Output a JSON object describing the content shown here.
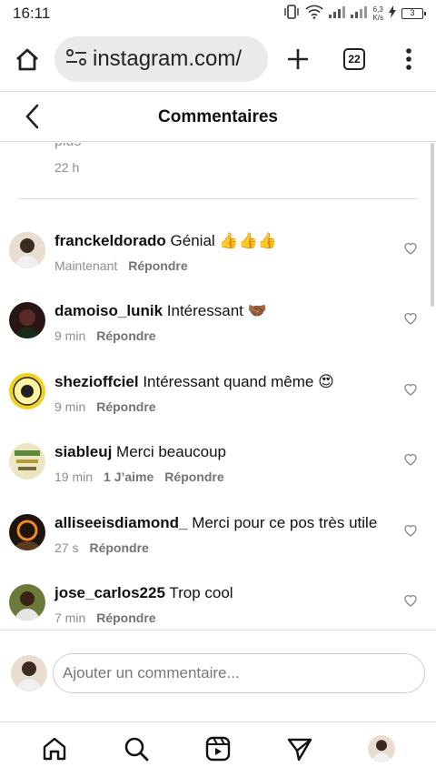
{
  "status_bar": {
    "time": "16:11",
    "speed_value": "6,3",
    "speed_unit": "K/s",
    "battery": "3"
  },
  "browser": {
    "url": "instagram.com/",
    "tab_count": "22"
  },
  "header": {
    "title": "Commentaires"
  },
  "previous_comment": {
    "text_tail": "plus",
    "time": "22 h"
  },
  "comments": [
    {
      "user": "franckeldorado",
      "text": "Génial 👍👍👍",
      "time": "Maintenant",
      "likes": "",
      "reply": "Répondre",
      "avatar_color": "#d8c7b5"
    },
    {
      "user": "damoiso_lunik",
      "text": "Intéressant 🤝🏾",
      "time": "9 min",
      "likes": "",
      "reply": "Répondre",
      "avatar_color": "#3a1a1a"
    },
    {
      "user": "shezioffciel",
      "text": "Intéressant quand même 😍",
      "time": "9 min",
      "likes": "",
      "reply": "Répondre",
      "avatar_color": "#f1d21c"
    },
    {
      "user": "siableuj",
      "text": "Merci beaucoup",
      "time": "19 min",
      "likes": "1 J’aime",
      "reply": "Répondre",
      "avatar_color": "#e9e2b8"
    },
    {
      "user": "alliseeisdiamond_",
      "text": "Merci pour ce pos très utile",
      "time": "27 s",
      "likes": "",
      "reply": "Répondre",
      "avatar_color": "#2b1a12"
    },
    {
      "user": "jose_carlos225",
      "text": "Trop cool",
      "time": "7 min",
      "likes": "",
      "reply": "Répondre",
      "avatar_color": "#6b7a3a"
    }
  ],
  "comment_input": {
    "placeholder": "Ajouter un commentaire..."
  },
  "bottom_nav": [
    "home-icon",
    "search-icon",
    "reels-icon",
    "direct-icon",
    "profile-avatar"
  ]
}
